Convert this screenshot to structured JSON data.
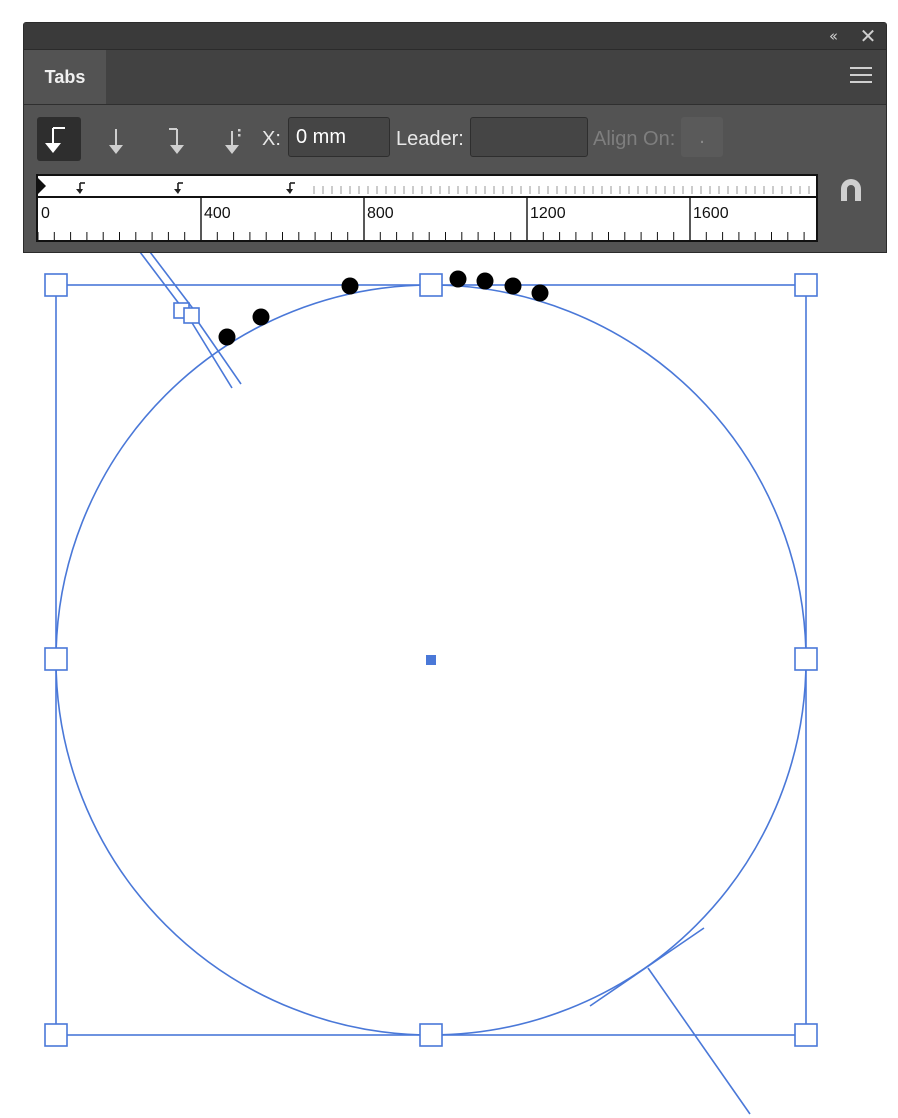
{
  "panel": {
    "title": "Tabs",
    "controls": {
      "collapse_icon": "double-chevron-left-icon",
      "close_icon": "close-icon",
      "menu_icon": "hamburger-menu-icon"
    },
    "tab_types": [
      {
        "name": "left-justified-tab",
        "icon": "left-justified-tab-icon",
        "selected": true
      },
      {
        "name": "center-justified-tab",
        "icon": "center-justified-tab-icon",
        "selected": false
      },
      {
        "name": "right-justified-tab",
        "icon": "right-justified-tab-icon",
        "selected": false
      },
      {
        "name": "decimal-justified-tab",
        "icon": "decimal-justified-tab-icon",
        "selected": false
      }
    ],
    "x_label": "X:",
    "x_value": "0 mm",
    "leader_label": "Leader:",
    "leader_value": "",
    "align_on_label": "Align On:",
    "align_on_value": ".",
    "snap_icon": "magnet-icon",
    "ruler": {
      "labels": [
        "0",
        "400",
        "800",
        "1200",
        "1600"
      ],
      "tab_stops": [
        "left",
        "left",
        "left"
      ]
    }
  },
  "colors": {
    "panel_bg": "#535353",
    "selection": "#4a78d8",
    "text_dots": "#000000"
  }
}
